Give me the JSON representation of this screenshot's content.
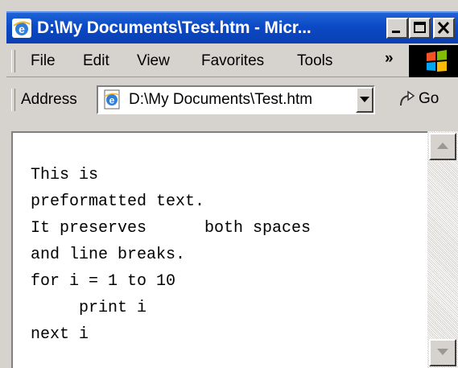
{
  "window": {
    "title": "D:\\My Documents\\Test.htm - Micr...",
    "icon": "ie-icon",
    "controls": [
      "minimize-icon",
      "maximize-icon",
      "close-icon"
    ]
  },
  "menu": {
    "items": [
      "File",
      "Edit",
      "View",
      "Favorites",
      "Tools"
    ],
    "overflow": "»"
  },
  "address_bar": {
    "label": "Address",
    "value": "D:\\My Documents\\Test.htm",
    "go_label": "Go"
  },
  "content": {
    "preformatted": "This is\npreformatted text.\nIt preserves      both spaces\nand line breaks.\nfor i = 1 to 10\n     print i\nnext i"
  },
  "colors": {
    "titlebar": "#0b49c5",
    "chrome": "#d6d3ce",
    "content_bg": "#ffffff"
  }
}
